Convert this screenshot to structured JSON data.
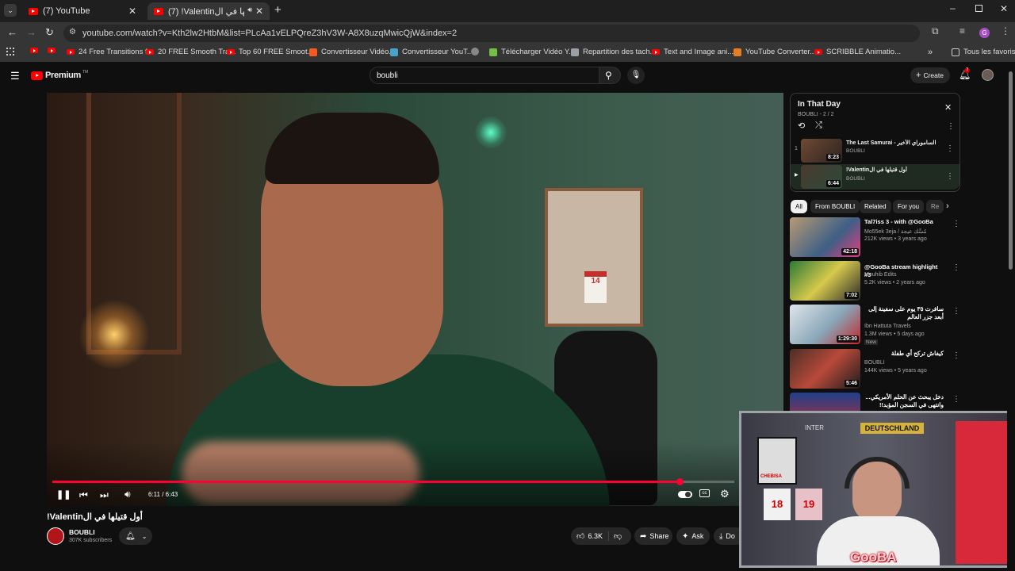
{
  "browser": {
    "tabs": [
      {
        "label": "(7) YouTube"
      },
      {
        "label": "(7) !Valentinأول قتيلها في ال"
      }
    ],
    "url": "youtube.com/watch?v=Kth2lw2HtbM&list=PLcAa1vELPQreZ3hV3W-A8X8uzqMwicQjW&index=2",
    "profile_initial": "G",
    "bookmarks": [
      "24 Free Transitions f...",
      "20 FREE Smooth Tra...",
      "Top 60 FREE Smoot...",
      "Convertisseur Vidéo...",
      "Convertisseur YouT...",
      "Télécharger Vidéo Y...",
      "Repartition des tach...",
      "Text and Image ani...",
      "YouTube Converter...",
      "SCRIBBLE Animatio..."
    ],
    "bookmarks_more": "»",
    "all_bookmarks": "Tous les favoris"
  },
  "youtube": {
    "logo_text": "Premium",
    "logo_tm": "TM",
    "search_value": "boubli",
    "create_label": "Create",
    "notif_count": "7"
  },
  "video": {
    "time": "6:11 / 6:43",
    "progress_fraction": 0.92,
    "title": "!Valentinأول قتيلها في ال",
    "channel": "BOUBLI",
    "subscribers": "307K subscribers",
    "likes": "6.3K",
    "share_label": "Share",
    "ask_label": "Ask",
    "download_label": "Do",
    "calendar_day": "14"
  },
  "playlist": {
    "title": "In That Day",
    "meta": "BOUBLI - 2 / 2",
    "items": [
      {
        "index": "1",
        "title": "The Last Samurai - الساموراي الأخير",
        "channel": "BOUBLI",
        "duration": "8:23"
      },
      {
        "index": "▶",
        "title": "!Valentinأول قتيلها في ال",
        "channel": "BOUBLI",
        "duration": "6:44"
      }
    ]
  },
  "chips": [
    "All",
    "From BOUBLI",
    "Related",
    "For you",
    "Re"
  ],
  "recommendations": [
    {
      "title": "Tal7iss 3 - with @GooBa",
      "channel": "Mo55ek 3eja / مُسِّك عيجة",
      "views": "212K views • 3 years ago",
      "duration": "42:18",
      "badge": ""
    },
    {
      "title": "@GooBa  stream highlight #3",
      "channel": "Mouhib Edits",
      "views": "5.2K views • 2 years ago",
      "duration": "7:02",
      "badge": ""
    },
    {
      "title": "سافرت ٣٥ يوم على سفينة إلى أبعد جزر العالم",
      "channel": "Ibn Hattuta Travels",
      "views": "1.3M views • 5 days ago",
      "duration": "1:29:30",
      "badge": "New"
    },
    {
      "title": "كيفاش تركح أي طفلة",
      "channel": "BOUBLI",
      "views": "144K views • 5 years ago",
      "duration": "5:46",
      "badge": ""
    },
    {
      "title": "دخل يبحث عن الحلم الأمريكي... وانتهى في السجن المؤبد!!",
      "channel": "",
      "views": "",
      "duration": "",
      "badge": ""
    }
  ],
  "webcam": {
    "banner_text": "DEUTSCHLAND",
    "inter_text": "INTER",
    "poster_text": "CHEBISA",
    "jersey_number_1": "18",
    "jersey_number_2": "19",
    "watermark": "GooBA"
  }
}
